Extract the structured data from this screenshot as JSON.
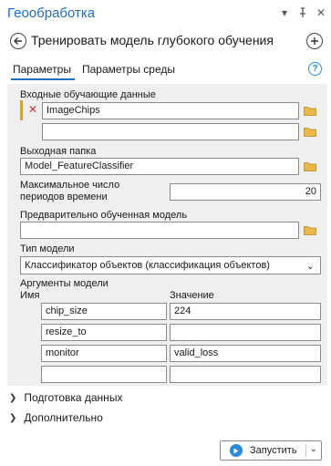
{
  "header": {
    "pane_title": "Геообработка",
    "tool_title": "Тренировать модель глубокого обучения"
  },
  "tabs": [
    {
      "label": "Параметры",
      "active": true
    },
    {
      "label": "Параметры среды",
      "active": false
    }
  ],
  "params": {
    "input_label": "Входные обучающие данные",
    "input_values": [
      "ImageChips",
      ""
    ],
    "output_label": "Выходная папка",
    "output_value": "Model_FeatureClassifier",
    "max_epochs_label_1": "Максимальное число",
    "max_epochs_label_2": "периодов времени",
    "max_epochs_value": "20",
    "pretrained_label": "Предварительно обученная модель",
    "pretrained_value": "",
    "model_type_label": "Тип модели",
    "model_type_value": "Классификатор объектов (классификация объектов)",
    "model_args_label": "Аргументы модели",
    "col_name": "Имя",
    "col_value": "Значение",
    "model_args": [
      {
        "name": "chip_size",
        "value": "224"
      },
      {
        "name": "resize_to",
        "value": ""
      },
      {
        "name": "monitor",
        "value": "valid_loss"
      },
      {
        "name": "",
        "value": ""
      }
    ]
  },
  "sections": {
    "data_prep": "Подготовка данных",
    "advanced": "Дополнительно"
  },
  "run_button": "Запустить",
  "colors": {
    "accent": "#1f6fc0",
    "panel_bg": "#efefef",
    "folder": "#e8b84a",
    "error": "#d0302a"
  }
}
